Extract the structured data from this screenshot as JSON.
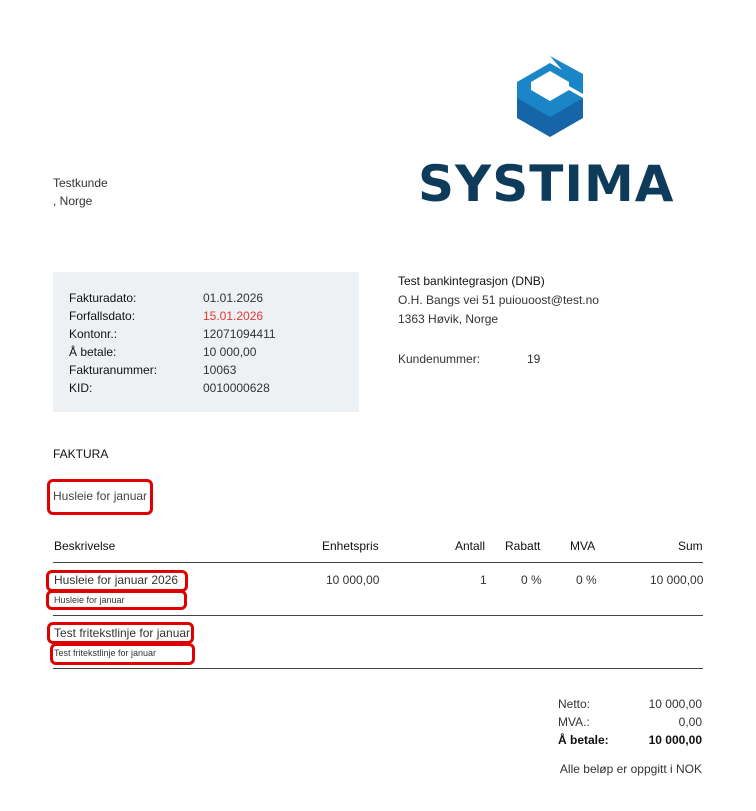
{
  "customer": {
    "name": "Testkunde",
    "address": ", Norge"
  },
  "logo": {
    "text": "SYSTIMA",
    "color": "#0e3b5a",
    "accent": "#1a86c8"
  },
  "invoice_info": {
    "rows": [
      {
        "label": "Fakturadato:",
        "value": "01.01.2026"
      },
      {
        "label": "Forfallsdato:",
        "value": "15.01.2026"
      },
      {
        "label": "Kontonr.:",
        "value": "12071094411"
      },
      {
        "label": "Å betale:",
        "value": "10 000,00"
      },
      {
        "label": "Fakturanummer:",
        "value": "10063"
      },
      {
        "label": "KID:",
        "value": "0010000628"
      }
    ]
  },
  "company": {
    "name": "Test bankintegrasjon (DNB)",
    "street": "O.H. Bangs vei 51 puiouoost@test.no",
    "city": "1363 Høvik, Norge",
    "customer_number_label": "Kundenummer:",
    "customer_number": "19"
  },
  "doc_title": "FAKTURA",
  "subject": "Husleie for januar",
  "table": {
    "headers": {
      "description": "Beskrivelse",
      "unit_price": "Enhetspris",
      "quantity": "Antall",
      "discount": "Rabatt",
      "vat": "MVA",
      "sum": "Sum"
    },
    "rows": [
      {
        "description": "Husleie for januar 2026",
        "note": "Husleie for januar",
        "unit_price": "10 000,00",
        "quantity": "1",
        "discount": "0 %",
        "vat": "0 %",
        "sum": "10 000,00"
      },
      {
        "description": "Test fritekstlinje for januar",
        "note": "Test fritekstlinje for januar"
      }
    ]
  },
  "totals": {
    "net_label": "Netto:",
    "net": "10 000,00",
    "vat_label": "MVA.:",
    "vat": "0,00",
    "due_label": "Å betale:",
    "due": "10 000,00",
    "currency_note": "Alle beløp er oppgitt i NOK"
  },
  "highlight_color": "#e00000"
}
